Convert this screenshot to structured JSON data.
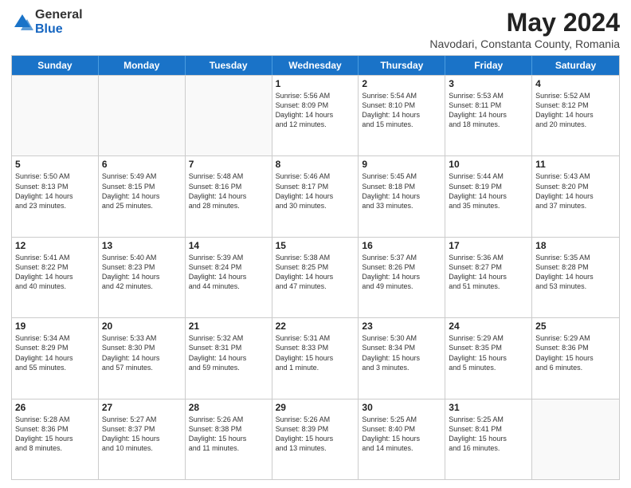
{
  "logo": {
    "general": "General",
    "blue": "Blue"
  },
  "header": {
    "title": "May 2024",
    "subtitle": "Navodari, Constanta County, Romania"
  },
  "days": [
    "Sunday",
    "Monday",
    "Tuesday",
    "Wednesday",
    "Thursday",
    "Friday",
    "Saturday"
  ],
  "weeks": [
    [
      {
        "day": "",
        "empty": true
      },
      {
        "day": "",
        "empty": true
      },
      {
        "day": "",
        "empty": true
      },
      {
        "day": "1",
        "lines": [
          "Sunrise: 5:56 AM",
          "Sunset: 8:09 PM",
          "Daylight: 14 hours",
          "and 12 minutes."
        ]
      },
      {
        "day": "2",
        "lines": [
          "Sunrise: 5:54 AM",
          "Sunset: 8:10 PM",
          "Daylight: 14 hours",
          "and 15 minutes."
        ]
      },
      {
        "day": "3",
        "lines": [
          "Sunrise: 5:53 AM",
          "Sunset: 8:11 PM",
          "Daylight: 14 hours",
          "and 18 minutes."
        ]
      },
      {
        "day": "4",
        "lines": [
          "Sunrise: 5:52 AM",
          "Sunset: 8:12 PM",
          "Daylight: 14 hours",
          "and 20 minutes."
        ]
      }
    ],
    [
      {
        "day": "5",
        "lines": [
          "Sunrise: 5:50 AM",
          "Sunset: 8:13 PM",
          "Daylight: 14 hours",
          "and 23 minutes."
        ]
      },
      {
        "day": "6",
        "lines": [
          "Sunrise: 5:49 AM",
          "Sunset: 8:15 PM",
          "Daylight: 14 hours",
          "and 25 minutes."
        ]
      },
      {
        "day": "7",
        "lines": [
          "Sunrise: 5:48 AM",
          "Sunset: 8:16 PM",
          "Daylight: 14 hours",
          "and 28 minutes."
        ]
      },
      {
        "day": "8",
        "lines": [
          "Sunrise: 5:46 AM",
          "Sunset: 8:17 PM",
          "Daylight: 14 hours",
          "and 30 minutes."
        ]
      },
      {
        "day": "9",
        "lines": [
          "Sunrise: 5:45 AM",
          "Sunset: 8:18 PM",
          "Daylight: 14 hours",
          "and 33 minutes."
        ]
      },
      {
        "day": "10",
        "lines": [
          "Sunrise: 5:44 AM",
          "Sunset: 8:19 PM",
          "Daylight: 14 hours",
          "and 35 minutes."
        ]
      },
      {
        "day": "11",
        "lines": [
          "Sunrise: 5:43 AM",
          "Sunset: 8:20 PM",
          "Daylight: 14 hours",
          "and 37 minutes."
        ]
      }
    ],
    [
      {
        "day": "12",
        "lines": [
          "Sunrise: 5:41 AM",
          "Sunset: 8:22 PM",
          "Daylight: 14 hours",
          "and 40 minutes."
        ]
      },
      {
        "day": "13",
        "lines": [
          "Sunrise: 5:40 AM",
          "Sunset: 8:23 PM",
          "Daylight: 14 hours",
          "and 42 minutes."
        ]
      },
      {
        "day": "14",
        "lines": [
          "Sunrise: 5:39 AM",
          "Sunset: 8:24 PM",
          "Daylight: 14 hours",
          "and 44 minutes."
        ]
      },
      {
        "day": "15",
        "lines": [
          "Sunrise: 5:38 AM",
          "Sunset: 8:25 PM",
          "Daylight: 14 hours",
          "and 47 minutes."
        ]
      },
      {
        "day": "16",
        "lines": [
          "Sunrise: 5:37 AM",
          "Sunset: 8:26 PM",
          "Daylight: 14 hours",
          "and 49 minutes."
        ]
      },
      {
        "day": "17",
        "lines": [
          "Sunrise: 5:36 AM",
          "Sunset: 8:27 PM",
          "Daylight: 14 hours",
          "and 51 minutes."
        ]
      },
      {
        "day": "18",
        "lines": [
          "Sunrise: 5:35 AM",
          "Sunset: 8:28 PM",
          "Daylight: 14 hours",
          "and 53 minutes."
        ]
      }
    ],
    [
      {
        "day": "19",
        "lines": [
          "Sunrise: 5:34 AM",
          "Sunset: 8:29 PM",
          "Daylight: 14 hours",
          "and 55 minutes."
        ]
      },
      {
        "day": "20",
        "lines": [
          "Sunrise: 5:33 AM",
          "Sunset: 8:30 PM",
          "Daylight: 14 hours",
          "and 57 minutes."
        ]
      },
      {
        "day": "21",
        "lines": [
          "Sunrise: 5:32 AM",
          "Sunset: 8:31 PM",
          "Daylight: 14 hours",
          "and 59 minutes."
        ]
      },
      {
        "day": "22",
        "lines": [
          "Sunrise: 5:31 AM",
          "Sunset: 8:33 PM",
          "Daylight: 15 hours",
          "and 1 minute."
        ]
      },
      {
        "day": "23",
        "lines": [
          "Sunrise: 5:30 AM",
          "Sunset: 8:34 PM",
          "Daylight: 15 hours",
          "and 3 minutes."
        ]
      },
      {
        "day": "24",
        "lines": [
          "Sunrise: 5:29 AM",
          "Sunset: 8:35 PM",
          "Daylight: 15 hours",
          "and 5 minutes."
        ]
      },
      {
        "day": "25",
        "lines": [
          "Sunrise: 5:29 AM",
          "Sunset: 8:36 PM",
          "Daylight: 15 hours",
          "and 6 minutes."
        ]
      }
    ],
    [
      {
        "day": "26",
        "lines": [
          "Sunrise: 5:28 AM",
          "Sunset: 8:36 PM",
          "Daylight: 15 hours",
          "and 8 minutes."
        ]
      },
      {
        "day": "27",
        "lines": [
          "Sunrise: 5:27 AM",
          "Sunset: 8:37 PM",
          "Daylight: 15 hours",
          "and 10 minutes."
        ]
      },
      {
        "day": "28",
        "lines": [
          "Sunrise: 5:26 AM",
          "Sunset: 8:38 PM",
          "Daylight: 15 hours",
          "and 11 minutes."
        ]
      },
      {
        "day": "29",
        "lines": [
          "Sunrise: 5:26 AM",
          "Sunset: 8:39 PM",
          "Daylight: 15 hours",
          "and 13 minutes."
        ]
      },
      {
        "day": "30",
        "lines": [
          "Sunrise: 5:25 AM",
          "Sunset: 8:40 PM",
          "Daylight: 15 hours",
          "and 14 minutes."
        ]
      },
      {
        "day": "31",
        "lines": [
          "Sunrise: 5:25 AM",
          "Sunset: 8:41 PM",
          "Daylight: 15 hours",
          "and 16 minutes."
        ]
      },
      {
        "day": "",
        "empty": true
      }
    ]
  ]
}
